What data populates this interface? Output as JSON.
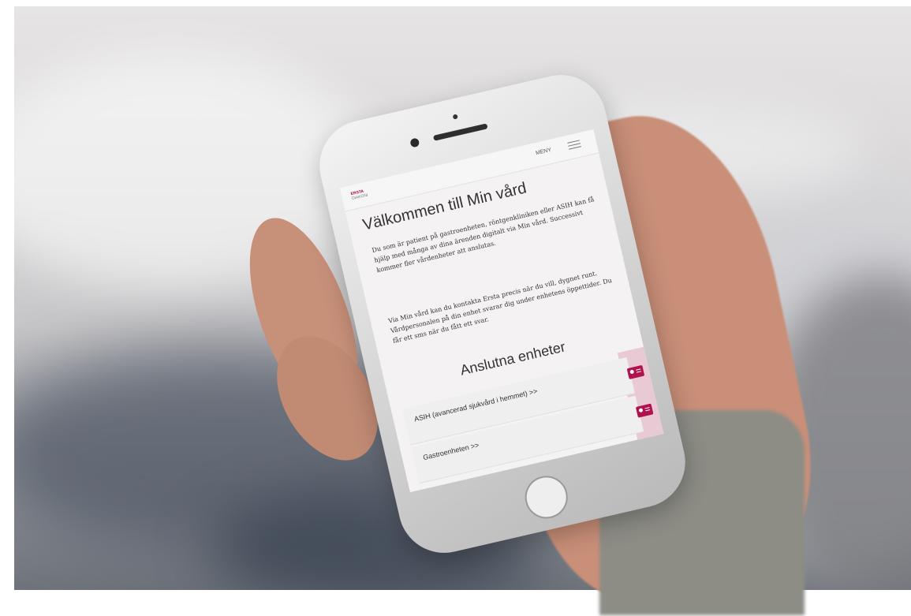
{
  "screen": {
    "logo": {
      "line1": "ERSTA",
      "line2": "DIAKONI"
    },
    "menu_label": "MENY",
    "title": "Välkommen till Min vård",
    "paragraphs": [
      "Du som är patient på gastroenheten, röntgenkliniken eller ASIH kan få hjälp med många av dina ärenden digitalt via Min vård. Successivt kommer fler vårdenheter att anslutas.",
      "Via Min vård kan du kontakta Ersta precis när du vill, dygnet runt. Vårdpersonalen på din enhet svarar dig under enhetens öppettider. Du får ett sms när du fått ett svar."
    ],
    "section_title": "Anslutna enheter",
    "units": [
      {
        "label": "ASIH (avancerad sjukvård i hemmet) >>",
        "icon": "id-card-icon"
      },
      {
        "label": "Gastroenheten >>",
        "icon": "id-card-icon"
      }
    ]
  },
  "colors": {
    "brand": "#b0124e",
    "accent_bg": "#e9c9d3"
  }
}
